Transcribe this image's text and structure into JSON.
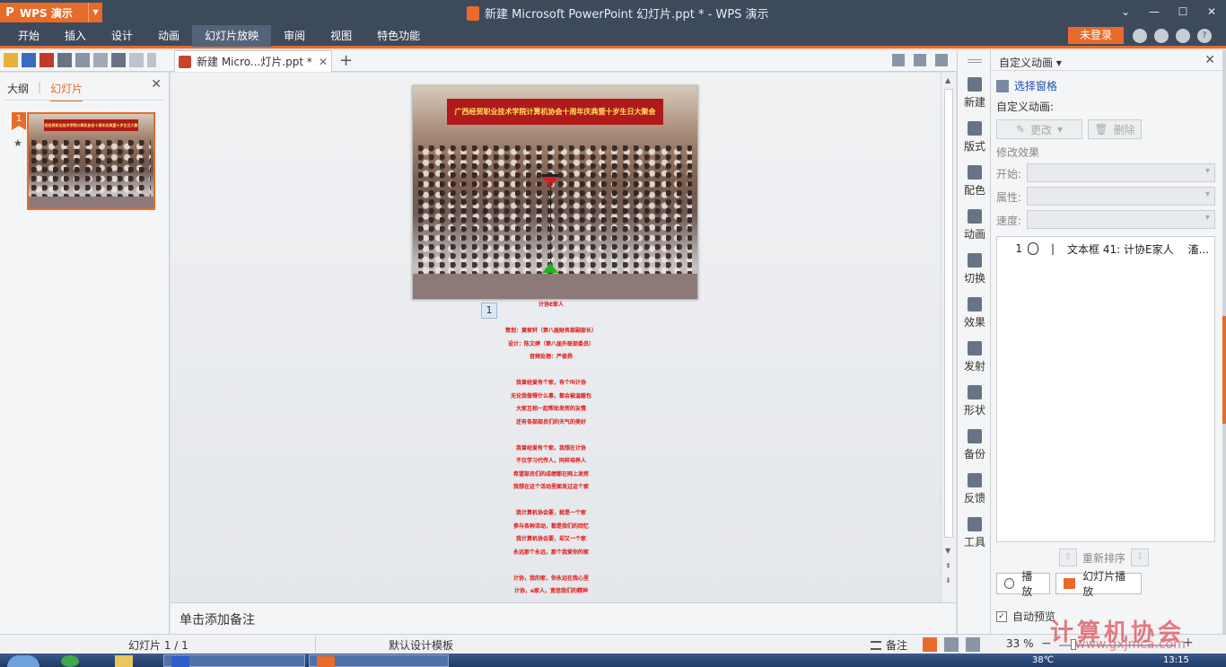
{
  "app": {
    "logo_p": "P",
    "logo_name": "WPS 演示",
    "window_title": "新建 Microsoft PowerPoint 幻灯片.ppt * - WPS 演示",
    "window_controls": [
      "⌄",
      "—",
      "☐",
      "✕"
    ]
  },
  "menu": {
    "items": [
      "开始",
      "插入",
      "设计",
      "动画",
      "幻灯片放映",
      "审阅",
      "视图",
      "特色功能"
    ],
    "active": "幻灯片放映",
    "login": "未登录"
  },
  "tabs": {
    "doc_tab": "新建 Micro...灯片.ppt *",
    "close": "✕",
    "add": "+"
  },
  "left_panel": {
    "tab_outline": "大纲",
    "tab_slides": "幻灯片",
    "close": "✕",
    "slide_number": "1",
    "star": "★"
  },
  "slide": {
    "banner": "广西经贸职业技术学院计算机协会十周年庆典暨十岁生日大聚会",
    "anim_badge": "1",
    "red_text_lines": [
      "计协E家人",
      "",
      "策划：黄家轩（第八届财务部副部长）",
      "设计：陈文婷（第八届外联部委员）",
      "音频处理：严俊扬",
      "",
      "我曾经爱有个家，有个叫计协",
      "无论我做得什么事，都会被温暖包",
      "大家互相一起帮助发挥的友情",
      "还有各部部员们的天气的美好",
      "",
      "我曾经爱有个家，我想在计协",
      "不仅学习代传人，同样培养人",
      "希望部员们的成绩都在网上发挥",
      "我想在这个活动里面发过这个家",
      "",
      "我计算机协会要，就是一个家",
      "参与各种活动，都是我们的回忆",
      "我计算机协会要，却又一个家",
      "永远那个永远，那个我爱你的家",
      "",
      "计协，我的家，你永远在我心里",
      "计协，e家人，宽信我们的精神"
    ]
  },
  "notes": {
    "placeholder": "单击添加备注"
  },
  "right_strip": [
    {
      "label": "新建",
      "icon": "new-icon"
    },
    {
      "label": "版式",
      "icon": "layout-icon"
    },
    {
      "label": "配色",
      "icon": "palette-icon"
    },
    {
      "label": "动画",
      "icon": "animation-icon"
    },
    {
      "label": "切换",
      "icon": "transition-icon"
    },
    {
      "label": "效果",
      "icon": "effects-icon"
    },
    {
      "label": "发射",
      "icon": "share-icon"
    },
    {
      "label": "形状",
      "icon": "shape-icon"
    },
    {
      "label": "备份",
      "icon": "backup-icon"
    },
    {
      "label": "反馈",
      "icon": "feedback-icon"
    },
    {
      "label": "工具",
      "icon": "toolbox-icon"
    }
  ],
  "task_pane": {
    "title": "自定义动画 ▾",
    "close": "✕",
    "select_pane": "选择窗格",
    "custom_anim_label": "自定义动画:",
    "change_btn": "更改",
    "delete_btn": "删除",
    "modify_effect": "修改效果",
    "start_label": "开始:",
    "property_label": "属性:",
    "speed_label": "速度:",
    "list_item": {
      "number": "1",
      "bar": "|",
      "name": "文本框 41: 计协E家人",
      "trail": "滀..."
    },
    "reorder": "重新排序",
    "reorder_up": "⇧",
    "reorder_down": "⇩",
    "play_btn": "播放",
    "slideshow_btn": "幻灯片播放",
    "auto_preview": "自动预览",
    "auto_preview_checked": "✓"
  },
  "status_bar": {
    "slide_info": "幻灯片 1 / 1",
    "template": "默认设计模板",
    "notes": "备注",
    "zoom": "33 %",
    "zoom_minus": "−",
    "zoom_plus": "+"
  },
  "watermark": {
    "line1": "计算机协会",
    "line2": "www.gxjmca.com"
  },
  "taskbar": {
    "temp": "38℃",
    "clock": "13:15"
  },
  "colors": {
    "accent": "#e86b2a",
    "titlebar": "#3d4a5c",
    "slide_text": "#e01010"
  }
}
